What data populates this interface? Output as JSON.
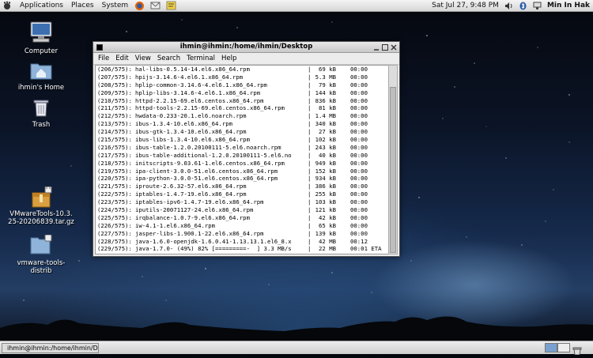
{
  "top_panel": {
    "menus": [
      "Applications",
      "Places",
      "System"
    ],
    "clock": "Sat Jul 27,  9:48 PM",
    "user": "Min In Hak"
  },
  "desktop_icons": [
    {
      "label": "Computer",
      "icon": "computer-icon"
    },
    {
      "label": "ihmin's Home",
      "icon": "home-folder-icon"
    },
    {
      "label": "Trash",
      "icon": "trash-icon"
    },
    {
      "label1": "VMwareTools-10.3.",
      "label2": "25-20206839.tar.gz",
      "icon": "archive-icon"
    },
    {
      "label1": "vmware-tools-",
      "label2": "distrib",
      "icon": "folder-icon"
    }
  ],
  "terminal": {
    "title": "ihmin@ihmin:/home/ihmin/Desktop",
    "menu": [
      "File",
      "Edit",
      "View",
      "Search",
      "Terminal",
      "Help"
    ],
    "lines": [
      {
        "n": "(206/575):",
        "pkg": "hal-libs-0.5.14-14.el6.x86_64.rpm",
        "size": "69 kB",
        "time": "00:00"
      },
      {
        "n": "(207/575):",
        "pkg": "hpijs-3.14.6-4.el6.1.x86_64.rpm",
        "size": "5.3 MB",
        "time": "00:00"
      },
      {
        "n": "(208/575):",
        "pkg": "hplip-common-3.14.6-4.el6.1.x86_64.rpm",
        "size": "79 kB",
        "time": "00:00"
      },
      {
        "n": "(209/575):",
        "pkg": "hplip-libs-3.14.6-4.el6.1.x86_64.rpm",
        "size": "144 kB",
        "time": "00:00"
      },
      {
        "n": "(210/575):",
        "pkg": "httpd-2.2.15-69.el6.centos.x86_64.rpm",
        "size": "836 kB",
        "time": "00:00"
      },
      {
        "n": "(211/575):",
        "pkg": "httpd-tools-2.2.15-69.el6.centos.x86_64.rpm",
        "size": "81 kB",
        "time": "00:00"
      },
      {
        "n": "(212/575):",
        "pkg": "hwdata-0.233-20.1.el6.noarch.rpm",
        "size": "1.4 MB",
        "time": "00:00"
      },
      {
        "n": "(213/575):",
        "pkg": "ibus-1.3.4-10.el6.x86_64.rpm",
        "size": "340 kB",
        "time": "00:00"
      },
      {
        "n": "(214/575):",
        "pkg": "ibus-gtk-1.3.4-10.el6.x86_64.rpm",
        "size": "27 kB",
        "time": "00:00"
      },
      {
        "n": "(215/575):",
        "pkg": "ibus-libs-1.3.4-10.el6.x86_64.rpm",
        "size": "102 kB",
        "time": "00:00"
      },
      {
        "n": "(216/575):",
        "pkg": "ibus-table-1.2.0.20100111-5.el6.noarch.rpm",
        "size": "243 kB",
        "time": "00:00"
      },
      {
        "n": "(217/575):",
        "pkg": "ibus-table-additional-1.2.0.20100111-5.el6.no",
        "size": "40 kB",
        "time": "00:00"
      },
      {
        "n": "(218/575):",
        "pkg": "initscripts-9.03.61-1.el6.centos.x86_64.rpm",
        "size": "949 kB",
        "time": "00:00"
      },
      {
        "n": "(219/575):",
        "pkg": "ipa-client-3.0.0-51.el6.centos.x86_64.rpm",
        "size": "152 kB",
        "time": "00:00"
      },
      {
        "n": "(220/575):",
        "pkg": "ipa-python-3.0.0-51.el6.centos.x86_64.rpm",
        "size": "934 kB",
        "time": "00:00"
      },
      {
        "n": "(221/575):",
        "pkg": "iproute-2.6.32-57.el6.x86_64.rpm",
        "size": "386 kB",
        "time": "00:00"
      },
      {
        "n": "(222/575):",
        "pkg": "iptables-1.4.7-19.el6.x86_64.rpm",
        "size": "255 kB",
        "time": "00:00"
      },
      {
        "n": "(223/575):",
        "pkg": "iptables-ipv6-1.4.7-19.el6.x86_64.rpm",
        "size": "103 kB",
        "time": "00:00"
      },
      {
        "n": "(224/575):",
        "pkg": "iputils-20071127-24.el6.x86_64.rpm",
        "size": "121 kB",
        "time": "00:00"
      },
      {
        "n": "(225/575):",
        "pkg": "irqbalance-1.0.7-9.el6.x86_64.rpm",
        "size": "42 kB",
        "time": "00:00"
      },
      {
        "n": "(226/575):",
        "pkg": "iw-4.1-1.el6.x86_64.rpm",
        "size": "65 kB",
        "time": "00:00"
      },
      {
        "n": "(227/575):",
        "pkg": "jasper-libs-1.900.1-22.el6.x86_64.rpm",
        "size": "139 kB",
        "time": "00:00"
      },
      {
        "n": "(228/575):",
        "pkg": "java-1.6.0-openjdk-1.6.0.41-1.13.13.1.el6_8.x",
        "size": "42 MB",
        "time": "00:12"
      },
      {
        "n": "(229/575):",
        "pkg": "java-1.7.0- (49%) 82% [=========-  ] 3.3 MB/s",
        "size": "22 MB",
        "time": "00:01 ETA"
      }
    ]
  },
  "bottom_panel": {
    "task": "ihmin@ihmin:/home/ihmin/Desktop"
  }
}
